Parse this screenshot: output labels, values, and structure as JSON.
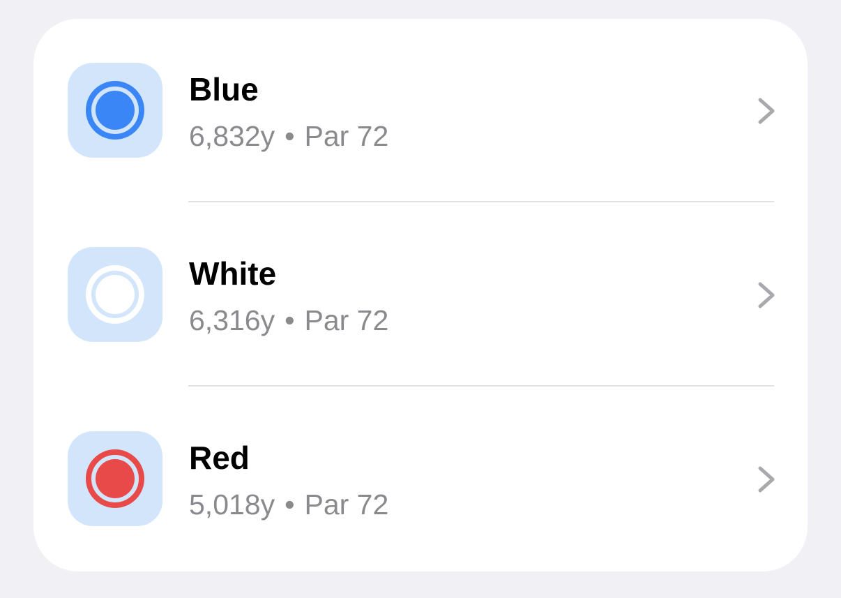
{
  "tees": [
    {
      "name": "Blue",
      "yardage": "6,832y",
      "separator": "•",
      "par": "Par 72",
      "icon": "blue-tee-marker-icon",
      "tile_color": "#d3e5fb",
      "ring_color": "#3a86f6",
      "dot_color": "#3a86f6",
      "gap_color": "#d3e5fb"
    },
    {
      "name": "White",
      "yardage": "6,316y",
      "separator": "•",
      "par": "Par 72",
      "icon": "white-tee-marker-icon",
      "tile_color": "#d3e5fb",
      "ring_color": "#ffffff",
      "dot_color": "#ffffff",
      "gap_color": "#d3e5fb"
    },
    {
      "name": "Red",
      "yardage": "5,018y",
      "separator": "•",
      "par": "Par 72",
      "icon": "red-tee-marker-icon",
      "tile_color": "#d3e5fb",
      "ring_color": "#e84a4a",
      "dot_color": "#e84a4a",
      "gap_color": "#d3e5fb"
    }
  ],
  "chevron_icon": "chevron-right-icon",
  "colors": {
    "background": "#f0f0f5",
    "card": "#ffffff",
    "title": "#000000",
    "subtitle": "#8a8a8e",
    "chevron": "#a8a8ad",
    "divider": "#e2e2e6"
  }
}
